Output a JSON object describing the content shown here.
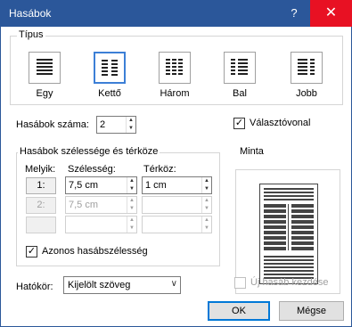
{
  "window": {
    "title": "Hasábok",
    "help_glyph": "?",
    "close_glyph": "✕"
  },
  "presets": {
    "legend": "Típus",
    "items": [
      {
        "label": "Egy",
        "key": "one"
      },
      {
        "label": "Kettő",
        "key": "two",
        "selected": true
      },
      {
        "label": "Három",
        "key": "three"
      },
      {
        "label": "Bal",
        "key": "left"
      },
      {
        "label": "Jobb",
        "key": "right"
      }
    ]
  },
  "column_count": {
    "label": "Hasábok száma:",
    "value": "2"
  },
  "separator": {
    "label": "Választóvonal",
    "checked": true,
    "check_glyph": "✓"
  },
  "width_spacing": {
    "legend": "Hasábok szélessége és térköze",
    "col_header": "Melyik:",
    "width_header": "Szélesség:",
    "spacing_header": "Térköz:",
    "rows": [
      {
        "col": "1:",
        "width": "7,5 cm",
        "spacing": "1 cm",
        "enabled": true
      },
      {
        "col": "2:",
        "width": "7,5 cm",
        "spacing": "",
        "enabled": false
      },
      {
        "col": "",
        "width": "",
        "spacing": "",
        "enabled": false
      }
    ],
    "equal_width": {
      "label": "Azonos hasábszélesség",
      "checked": true,
      "check_glyph": "✓"
    }
  },
  "preview": {
    "legend": "Minta"
  },
  "apply_to": {
    "label": "Hatókör:",
    "value": "Kijelölt szöveg",
    "chevron": "∨"
  },
  "new_column": {
    "label": "Új hasáb kezdése",
    "checked": false
  },
  "buttons": {
    "ok": "OK",
    "cancel": "Mégse"
  }
}
